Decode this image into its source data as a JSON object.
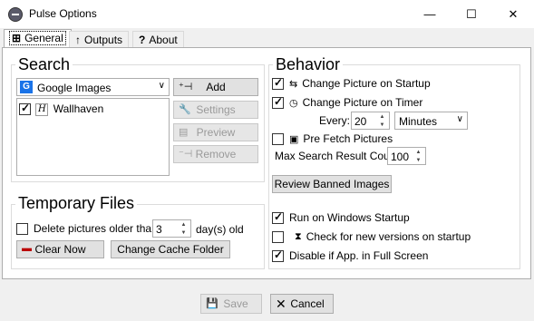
{
  "window": {
    "title": "Pulse Options",
    "min_glyph": "—",
    "max_glyph": "☐",
    "close_glyph": "✕"
  },
  "tabs": [
    {
      "label": "General",
      "icon": "sliders-icon"
    },
    {
      "label": "Outputs",
      "icon": "arrow-up-icon"
    },
    {
      "label": "About",
      "icon": "question-icon"
    }
  ],
  "search": {
    "title": "Search",
    "provider": "Google Images",
    "providers_list": [
      {
        "label": "Wallhaven",
        "checked": true
      }
    ],
    "buttons": {
      "add": "Add",
      "settings": "Settings",
      "preview": "Preview",
      "remove": "Remove"
    }
  },
  "temporary_files": {
    "title": "Temporary Files",
    "delete_label": "Delete pictures older than",
    "delete_checked": false,
    "days_value": "3",
    "days_unit": "day(s) old",
    "clear_now": "Clear Now",
    "change_cache": "Change Cache Folder"
  },
  "behavior": {
    "title": "Behavior",
    "change_on_startup": {
      "label": "Change Picture on Startup",
      "checked": true
    },
    "change_on_timer": {
      "label": "Change Picture on Timer",
      "checked": true
    },
    "every_label": "Every:",
    "every_value": "20",
    "every_unit": "Minutes",
    "prefetch": {
      "label": "Pre Fetch Pictures",
      "checked": false
    },
    "max_search_label": "Max Search Result Count:",
    "max_search_value": "100",
    "review_banned": "Review Banned Images",
    "run_on_startup": {
      "label": "Run on Windows Startup",
      "checked": true
    },
    "check_updates": {
      "label": "Check for new versions on startup",
      "checked": false
    },
    "disable_fullscreen": {
      "label": "Disable if App. in Full Screen",
      "checked": true
    }
  },
  "footer": {
    "save": "Save",
    "cancel": "Cancel"
  }
}
